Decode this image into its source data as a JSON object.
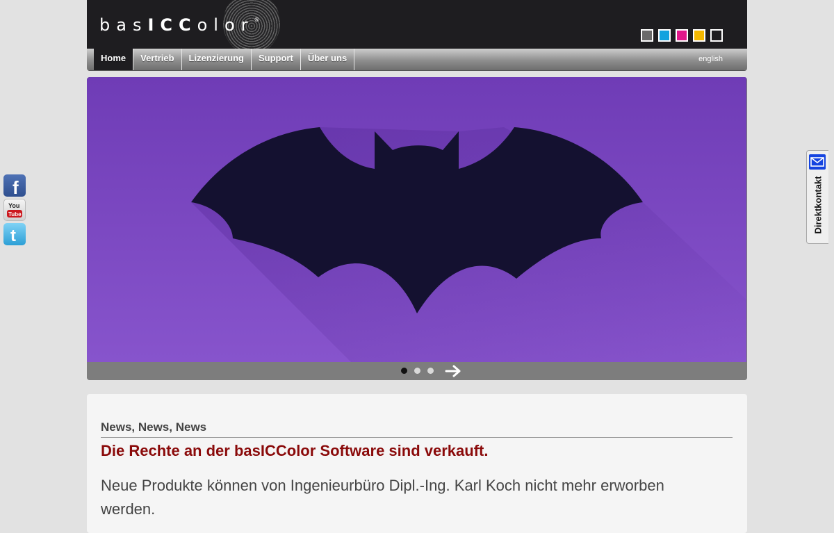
{
  "header": {
    "logo": {
      "part1": "bas",
      "part2": "ICC",
      "part3": "olor",
      "mark": "®"
    },
    "color_swatches": [
      "#6a6a6a",
      "#12a2df",
      "#e2178a",
      "#f4b800",
      "#1e1d20"
    ]
  },
  "nav": {
    "items": [
      {
        "label": "Home",
        "active": true
      },
      {
        "label": "Vertrieb",
        "active": false
      },
      {
        "label": "Lizenzierung",
        "active": false
      },
      {
        "label": "Support",
        "active": false
      },
      {
        "label": "Über uns",
        "active": false
      }
    ],
    "language": "english"
  },
  "slider": {
    "image": "bat-silhouette",
    "slide_count": 3,
    "active_slide": 1,
    "next_icon": "arrow-right-icon",
    "colors": {
      "background": "#7a45c2",
      "shape": "#141130"
    }
  },
  "social": [
    "facebook-icon",
    "youtube-icon",
    "twitter-icon"
  ],
  "contact": {
    "label": "Direktkontakt",
    "icon": "mail-icon"
  },
  "news": {
    "heading": "News, News, News",
    "headline": "Die Rechte an der basICColor Software sind verkauft.",
    "body": "Neue Produkte können von Ingenieurbüro Dipl.-Ing. Karl Koch nicht mehr erworben werden."
  }
}
